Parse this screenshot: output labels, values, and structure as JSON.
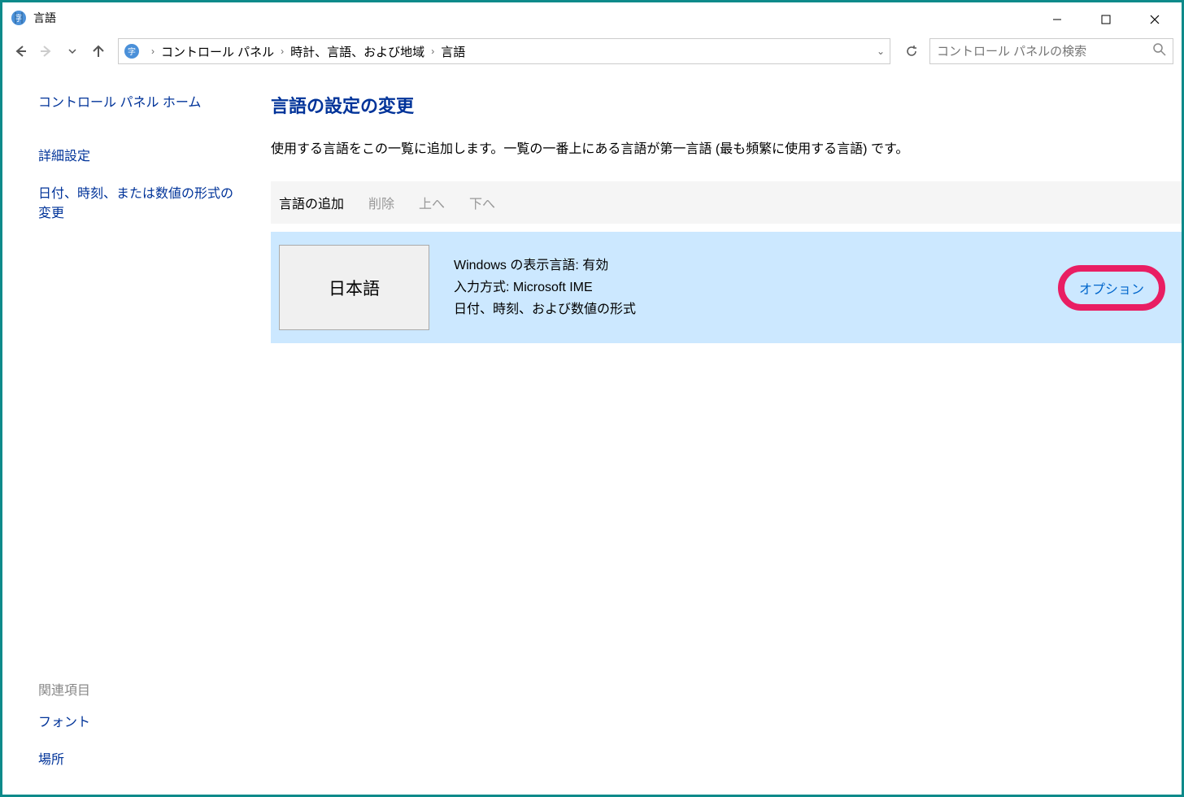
{
  "window": {
    "title": "言語"
  },
  "breadcrumb": {
    "items": [
      "コントロール パネル",
      "時計、言語、および地域",
      "言語"
    ]
  },
  "search": {
    "placeholder": "コントロール パネルの検索"
  },
  "sidebar": {
    "home": "コントロール パネル ホーム",
    "advanced": "詳細設定",
    "formats": "日付、時刻、または数値の形式の変更",
    "related_heading": "関連項目",
    "fonts": "フォント",
    "location": "場所"
  },
  "content": {
    "title": "言語の設定の変更",
    "description": "使用する言語をこの一覧に追加します。一覧の一番上にある言語が第一言語 (最も頻繁に使用する言語) です。"
  },
  "toolbar": {
    "add": "言語の追加",
    "remove": "削除",
    "up": "上へ",
    "down": "下へ"
  },
  "language_item": {
    "name": "日本語",
    "display_lang": "Windows の表示言語: 有効",
    "input_method": "入力方式: Microsoft IME",
    "formats": "日付、時刻、および数値の形式",
    "options": "オプション"
  }
}
